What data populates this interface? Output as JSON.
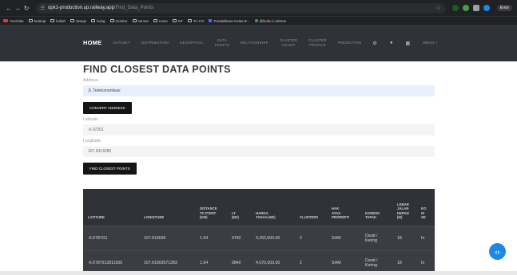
{
  "browser": {
    "url_host": "opk1-production.up.railway.app",
    "url_path": "/Find_Data_Points",
    "profile": "Error",
    "bookmarks": [
      "YouTube",
      "belanja",
      "kuliah",
      "design",
      "living",
      "monitor",
      "sensor",
      "Icons",
      "KP",
      "TA-CO",
      "Pendaftaran Kelas B...",
      "@lsufa | Linktree"
    ]
  },
  "nav": {
    "home": "HOME",
    "items": [
      [
        "DATASET",
        ""
      ],
      [
        "DISTRIBUTION",
        ""
      ],
      [
        "GEOSPATIAL",
        ""
      ],
      [
        "DATA",
        "POINTS"
      ],
      [
        "RELATIONSHIP",
        ""
      ],
      [
        "CLUSTER",
        "COUNT"
      ],
      [
        "CLUSTER",
        "PROFILE"
      ],
      [
        "PREDICTION",
        ""
      ]
    ],
    "menu": "MENU"
  },
  "page": {
    "title": "FIND CLOSEST DATA POINTS",
    "address_label": "Address:",
    "address_value": "Jl. Telekomunikasi",
    "convert_button": "CONVERT ADDRESS",
    "latitude_label": "Latitude:",
    "latitude_value": "-6.97261",
    "longitude_label": "Longitude:",
    "longitude_value": "107.6314285",
    "find_button": "FIND CLOSEST POINTS"
  },
  "table": {
    "headers": [
      [
        "LATITUDE"
      ],
      [
        "LONGITUDE"
      ],
      [
        "DISTANCE",
        "TO POINT",
        "(KM)"
      ],
      [
        "LT",
        "(M2)"
      ],
      [
        "HARGA",
        "TANAH (M2)"
      ],
      [
        "CLUSTERS"
      ],
      [
        "HAK",
        "ATAS",
        "PROPERTI"
      ],
      [
        "KONDISI",
        "TAPAK"
      ],
      [
        "LEBAR",
        "JALAN",
        "DEPAN",
        "(M)"
      ],
      [
        "KO",
        "W",
        "SE"
      ]
    ],
    "rows": [
      [
        "-6.9787G1",
        "107.619036",
        "1.54",
        "9782",
        "4,262,500.00",
        "2",
        "SHM",
        "Darat /",
        "Kering",
        "18",
        "In"
      ],
      [
        "-6.9787612811505",
        "107.61903571283",
        "1.54",
        "9840",
        "4,070,000.00",
        "2",
        "SHM",
        "Darat /",
        "Kering",
        "18",
        "In"
      ]
    ]
  },
  "colors": {
    "navbar": "#2f3237",
    "table_row": "#3a3d42",
    "fab": "#1e88e5"
  }
}
